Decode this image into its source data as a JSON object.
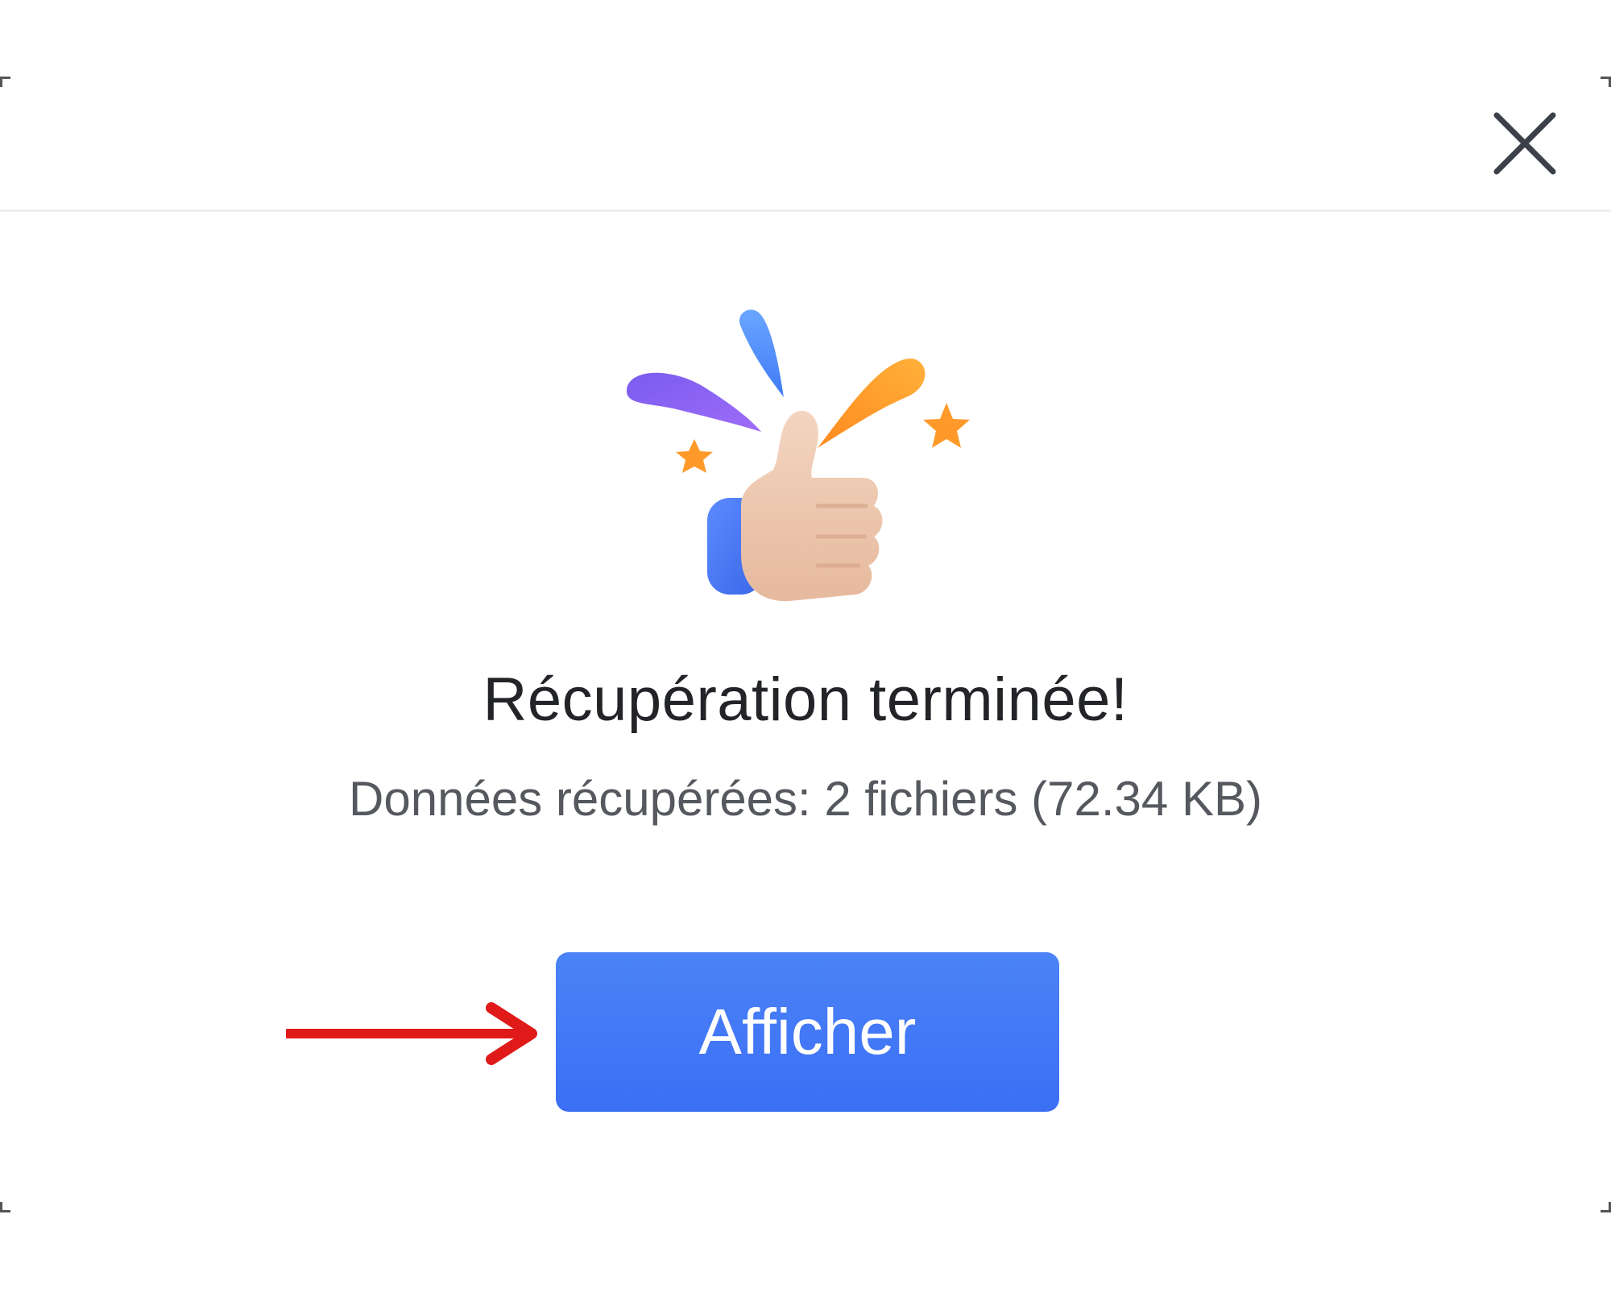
{
  "dialog": {
    "title": "Récupération terminée!",
    "summary": "Données récupérées: 2 fichiers (72.34 KB)",
    "primary_button_label": "Afficher",
    "close_icon": "close-icon",
    "illustration_icon": "thumbs-up-celebration-icon",
    "annotation_icon": "red-arrow-icon"
  },
  "colors": {
    "primary": "#3b6ff5",
    "annotation_arrow": "#e01919",
    "title_text": "#222428",
    "subtitle_text": "#55585e"
  }
}
